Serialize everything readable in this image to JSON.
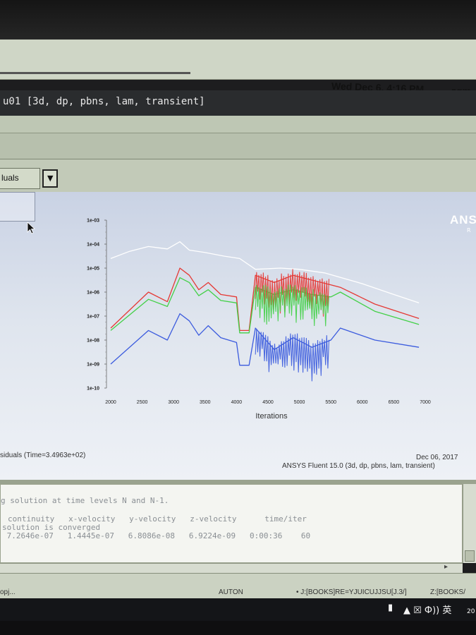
{
  "system": {
    "clock": "Wed Dec  6,  4:16 PM",
    "user": "zqm"
  },
  "window": {
    "title": "u01 [3d, dp, pbns, lam, transient]"
  },
  "toolbar": {
    "graphics_select": "luals"
  },
  "graphics": {
    "brand": "ANS",
    "brand_sub": "R",
    "caption_left": "siduals  (Time=3.4963e+02)",
    "caption_date": "Dec 06, 2017",
    "caption_version": "ANSYS Fluent 15.0 (3d, dp, pbns, lam, transient)"
  },
  "chart_data": {
    "type": "line",
    "xlabel": "Iterations",
    "ylabel": "",
    "x_ticks": [
      "2000",
      "2500",
      "3000",
      "3500",
      "4000",
      "4500",
      "5000",
      "5500",
      "6000",
      "6500",
      "7000"
    ],
    "y_ticks": [
      "1e-03",
      "1e-04",
      "1e-05",
      "1e-06",
      "1e-07",
      "1e-08",
      "1e-09",
      "1e-10"
    ],
    "xlim": [
      2000,
      7000
    ],
    "ylim_log10": [
      -10,
      -3
    ],
    "y_scale": "log",
    "grid": false,
    "series": [
      {
        "color": "#ffffff",
        "points": [
          [
            2000,
            -4.6
          ],
          [
            2300,
            -4.3
          ],
          [
            2600,
            -4.1
          ],
          [
            2900,
            -4.2
          ],
          [
            3100,
            -3.9
          ],
          [
            3250,
            -4.25
          ],
          [
            3500,
            -4.35
          ],
          [
            3800,
            -4.5
          ],
          [
            4050,
            -4.6
          ],
          [
            4300,
            -5.05
          ],
          [
            4700,
            -5.0
          ],
          [
            5000,
            -5.05
          ],
          [
            5400,
            -5.2
          ],
          [
            5600,
            -5.35
          ],
          [
            6000,
            -5.65
          ],
          [
            6500,
            -6.1
          ],
          [
            6900,
            -6.45
          ]
        ]
      },
      {
        "color": "#e53935",
        "points": [
          [
            2000,
            -7.5
          ],
          [
            2600,
            -6.0
          ],
          [
            2900,
            -6.4
          ],
          [
            3100,
            -5.0
          ],
          [
            3250,
            -5.3
          ],
          [
            3400,
            -5.9
          ],
          [
            3550,
            -5.6
          ],
          [
            3750,
            -6.1
          ],
          [
            4000,
            -6.2
          ],
          [
            4050,
            -7.6
          ],
          [
            4200,
            -7.6
          ],
          [
            4300,
            -5.3
          ],
          [
            4600,
            -5.6
          ],
          [
            4900,
            -5.3
          ],
          [
            5200,
            -5.5
          ],
          [
            5500,
            -5.7
          ],
          [
            5650,
            -5.8
          ],
          [
            6200,
            -6.5
          ],
          [
            6900,
            -7.1
          ]
        ]
      },
      {
        "color": "#43d047",
        "points": [
          [
            2000,
            -7.6
          ],
          [
            2600,
            -6.3
          ],
          [
            2900,
            -6.6
          ],
          [
            3100,
            -5.4
          ],
          [
            3250,
            -5.6
          ],
          [
            3400,
            -6.15
          ],
          [
            3550,
            -5.9
          ],
          [
            3750,
            -6.35
          ],
          [
            4000,
            -6.45
          ],
          [
            4050,
            -7.7
          ],
          [
            4200,
            -7.7
          ],
          [
            4300,
            -5.8
          ],
          [
            4600,
            -6.1
          ],
          [
            4900,
            -5.9
          ],
          [
            5200,
            -6.1
          ],
          [
            5500,
            -6.2
          ],
          [
            5650,
            -6.0
          ],
          [
            6200,
            -6.8
          ],
          [
            6900,
            -7.35
          ]
        ]
      },
      {
        "color": "#3b5bde",
        "points": [
          [
            2000,
            -9.0
          ],
          [
            2600,
            -7.6
          ],
          [
            2900,
            -8.0
          ],
          [
            3100,
            -6.9
          ],
          [
            3250,
            -7.2
          ],
          [
            3400,
            -7.8
          ],
          [
            3550,
            -7.4
          ],
          [
            3750,
            -7.9
          ],
          [
            4000,
            -8.1
          ],
          [
            4050,
            -9.05
          ],
          [
            4200,
            -9.05
          ],
          [
            4300,
            -7.5
          ],
          [
            4600,
            -8.4
          ],
          [
            4900,
            -7.9
          ],
          [
            5200,
            -8.3
          ],
          [
            5500,
            -8.0
          ],
          [
            5650,
            -7.5
          ],
          [
            6200,
            -8.0
          ],
          [
            6900,
            -8.3
          ]
        ]
      }
    ]
  },
  "console": {
    "line1": "g solution at time levels N and N-1.",
    "headers": "continuity   x-velocity   y-velocity   z-velocity      time/iter",
    "status": "solution is converged",
    "values": " 7.2646e-07   1.4445e-07   6.8086e-08   6.9224e-09   0:00:36    60"
  },
  "taskbar": {
    "item_left": "opj...",
    "item_mid": "AUTON",
    "item_right1": "• J:[BOOKS]RE=YJUICUJJSU[J.3/]",
    "item_right2": "Z:[BOOKS/",
    "tray": "▲  ☒ Ф)) 英",
    "tray_extra": "20"
  }
}
